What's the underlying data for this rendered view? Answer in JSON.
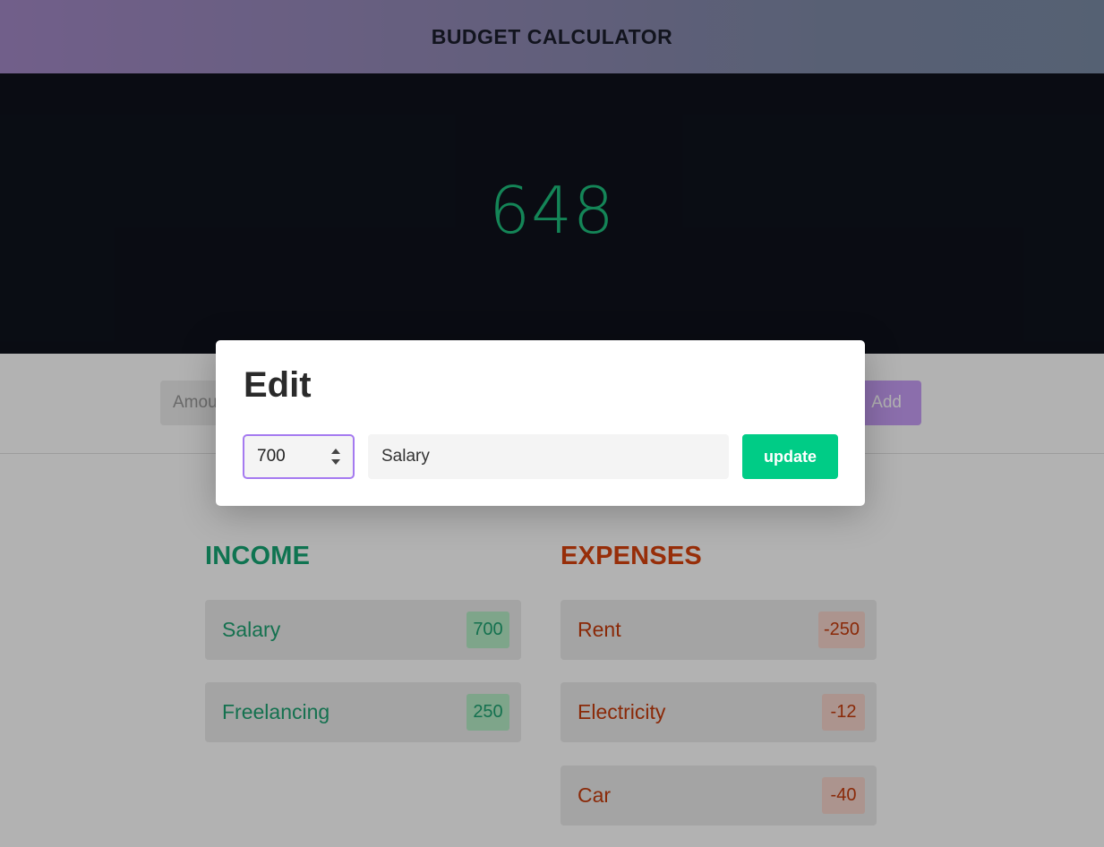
{
  "header": {
    "title": "BUDGET CALCULATOR"
  },
  "balance": {
    "value": "648"
  },
  "add_form": {
    "amount_placeholder": "Amount",
    "add_label": "Add"
  },
  "income": {
    "heading": "INCOME",
    "items": [
      {
        "name": "Salary",
        "amount": "700"
      },
      {
        "name": "Freelancing",
        "amount": "250"
      }
    ]
  },
  "expenses": {
    "heading": "EXPENSES",
    "items": [
      {
        "name": "Rent",
        "amount": "-250"
      },
      {
        "name": "Electricity",
        "amount": "-12"
      },
      {
        "name": "Car",
        "amount": "-40"
      }
    ]
  },
  "edit_modal": {
    "title": "Edit",
    "amount_value": "700",
    "name_value": "Salary",
    "update_label": "update"
  },
  "colors": {
    "income": "#1ea272",
    "expense": "#c63c0c",
    "update_button": "#00cc86",
    "balance": "#1dbf7d",
    "focus_border": "#a57af0"
  }
}
